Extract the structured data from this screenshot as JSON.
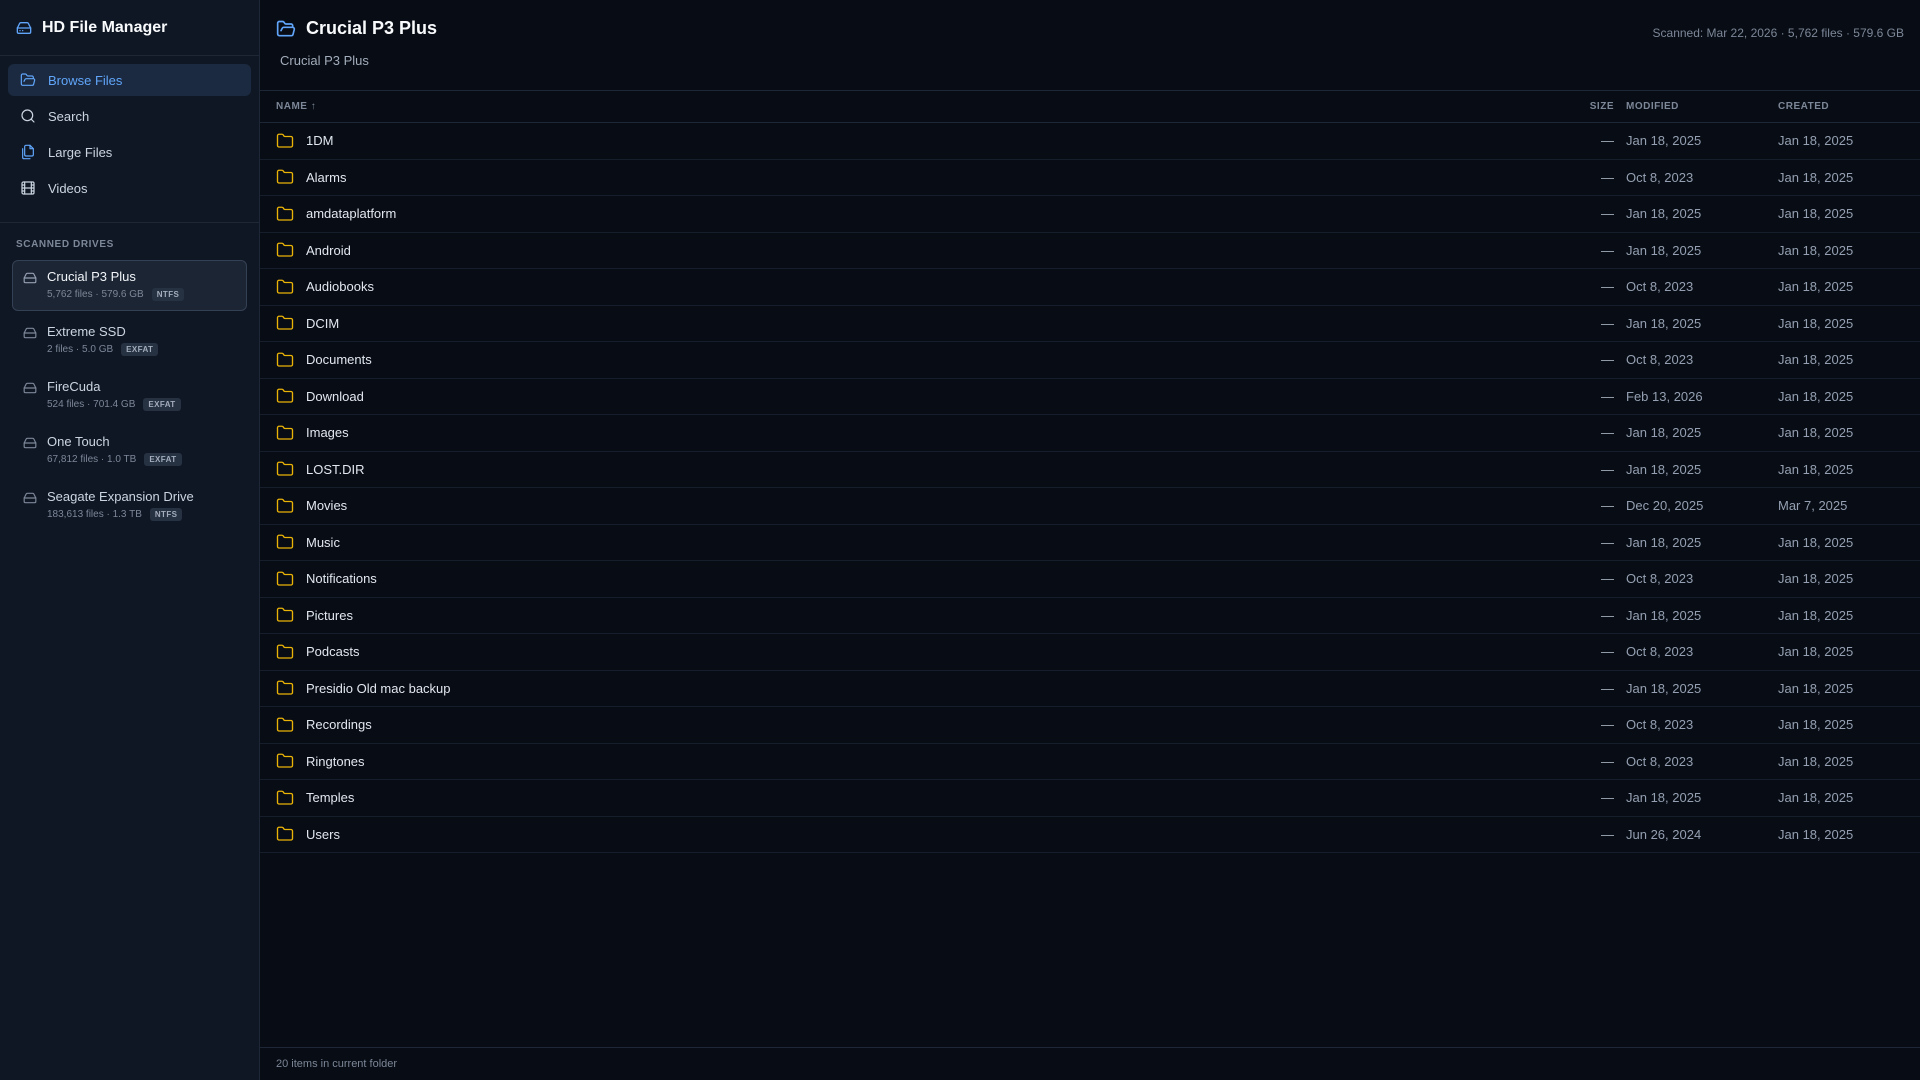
{
  "app": {
    "title": "HD File Manager"
  },
  "colors": {
    "accent": "#60a5fa",
    "folder": "#eab308",
    "background": "#080c14",
    "sidebar": "#0f1724"
  },
  "nav": [
    {
      "label": "Browse Files",
      "icon": "folder-open-icon",
      "active": true
    },
    {
      "label": "Search",
      "icon": "search-icon",
      "active": false
    },
    {
      "label": "Large Files",
      "icon": "stacked-files-icon",
      "active": false
    },
    {
      "label": "Videos",
      "icon": "film-icon",
      "active": false
    }
  ],
  "drives_heading": "SCANNED DRIVES",
  "drives": [
    {
      "name": "Crucial P3 Plus",
      "meta": "5,762 files · 579.6 GB",
      "fs": "NTFS",
      "active": true
    },
    {
      "name": "Extreme SSD",
      "meta": "2 files · 5.0 GB",
      "fs": "EXFAT",
      "active": false
    },
    {
      "name": "FireCuda",
      "meta": "524 files · 701.4 GB",
      "fs": "EXFAT",
      "active": false
    },
    {
      "name": "One Touch",
      "meta": "67,812 files · 1.0 TB",
      "fs": "EXFAT",
      "active": false
    },
    {
      "name": "Seagate Expansion Drive",
      "meta": "183,613 files · 1.3 TB",
      "fs": "NTFS",
      "active": false
    }
  ],
  "header": {
    "title": "Crucial P3 Plus",
    "scan_info": "Scanned: Mar 22, 2026 · 5,762 files · 579.6 GB",
    "breadcrumb": "Crucial P3 Plus"
  },
  "columns": {
    "name": "NAME ↑",
    "size": "SIZE",
    "modified": "MODIFIED",
    "created": "CREATED"
  },
  "rows": [
    {
      "name": "1DM",
      "size": "—",
      "modified": "Jan 18, 2025",
      "created": "Jan 18, 2025"
    },
    {
      "name": "Alarms",
      "size": "—",
      "modified": "Oct 8, 2023",
      "created": "Jan 18, 2025"
    },
    {
      "name": "amdataplatform",
      "size": "—",
      "modified": "Jan 18, 2025",
      "created": "Jan 18, 2025"
    },
    {
      "name": "Android",
      "size": "—",
      "modified": "Jan 18, 2025",
      "created": "Jan 18, 2025"
    },
    {
      "name": "Audiobooks",
      "size": "—",
      "modified": "Oct 8, 2023",
      "created": "Jan 18, 2025"
    },
    {
      "name": "DCIM",
      "size": "—",
      "modified": "Jan 18, 2025",
      "created": "Jan 18, 2025"
    },
    {
      "name": "Documents",
      "size": "—",
      "modified": "Oct 8, 2023",
      "created": "Jan 18, 2025"
    },
    {
      "name": "Download",
      "size": "—",
      "modified": "Feb 13, 2026",
      "created": "Jan 18, 2025"
    },
    {
      "name": "Images",
      "size": "—",
      "modified": "Jan 18, 2025",
      "created": "Jan 18, 2025"
    },
    {
      "name": "LOST.DIR",
      "size": "—",
      "modified": "Jan 18, 2025",
      "created": "Jan 18, 2025"
    },
    {
      "name": "Movies",
      "size": "—",
      "modified": "Dec 20, 2025",
      "created": "Mar 7, 2025"
    },
    {
      "name": "Music",
      "size": "—",
      "modified": "Jan 18, 2025",
      "created": "Jan 18, 2025"
    },
    {
      "name": "Notifications",
      "size": "—",
      "modified": "Oct 8, 2023",
      "created": "Jan 18, 2025"
    },
    {
      "name": "Pictures",
      "size": "—",
      "modified": "Jan 18, 2025",
      "created": "Jan 18, 2025"
    },
    {
      "name": "Podcasts",
      "size": "—",
      "modified": "Oct 8, 2023",
      "created": "Jan 18, 2025"
    },
    {
      "name": "Presidio Old mac backup",
      "size": "—",
      "modified": "Jan 18, 2025",
      "created": "Jan 18, 2025"
    },
    {
      "name": "Recordings",
      "size": "—",
      "modified": "Oct 8, 2023",
      "created": "Jan 18, 2025"
    },
    {
      "name": "Ringtones",
      "size": "—",
      "modified": "Oct 8, 2023",
      "created": "Jan 18, 2025"
    },
    {
      "name": "Temples",
      "size": "—",
      "modified": "Jan 18, 2025",
      "created": "Jan 18, 2025"
    },
    {
      "name": "Users",
      "size": "—",
      "modified": "Jun 26, 2024",
      "created": "Jan 18, 2025"
    }
  ],
  "footer": {
    "status": "20 items in current folder"
  }
}
